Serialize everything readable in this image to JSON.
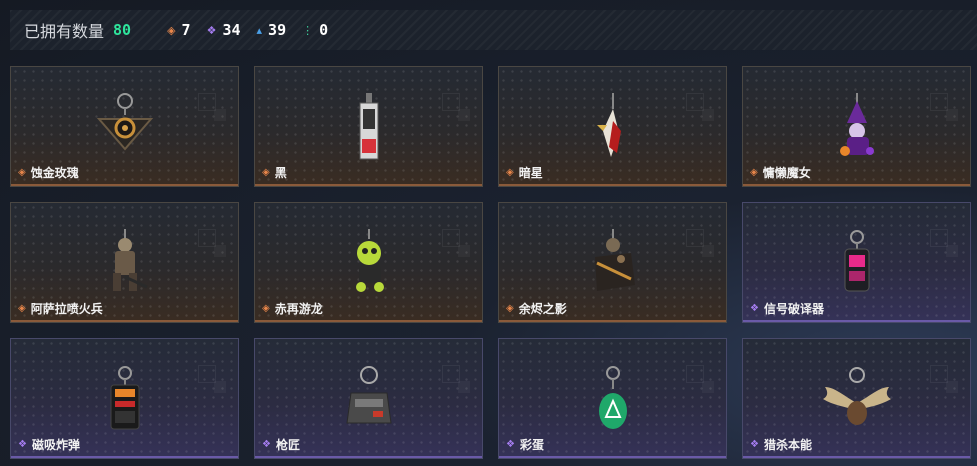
{
  "header": {
    "owned_label": "已拥有数量",
    "owned_count": "80",
    "stats": [
      {
        "icon": "orange-diamond-icon",
        "glyph": "◈",
        "color": "#e8864a",
        "value": "7"
      },
      {
        "icon": "purple-diamond-icon",
        "glyph": "❖",
        "color": "#a57df0",
        "value": "34"
      },
      {
        "icon": "blue-chevron-icon",
        "glyph": "▴",
        "color": "#4aa0e8",
        "value": "39"
      },
      {
        "icon": "green-dots-icon",
        "glyph": "⋮",
        "color": "#3fd7a0",
        "value": "0"
      }
    ]
  },
  "colors": {
    "orange": "#e8864a",
    "purple": "#a57df0"
  },
  "items": [
    {
      "name": "蚀金玫瑰",
      "rarity": "orange",
      "glyph": "◈"
    },
    {
      "name": "黑",
      "rarity": "orange",
      "glyph": "◈"
    },
    {
      "name": "暗星",
      "rarity": "orange",
      "glyph": "◈"
    },
    {
      "name": "慵懒魔女",
      "rarity": "orange",
      "glyph": "◈"
    },
    {
      "name": "阿萨拉喷火兵",
      "rarity": "orange",
      "glyph": "◈"
    },
    {
      "name": "赤再游龙",
      "rarity": "orange",
      "glyph": "◈"
    },
    {
      "name": "余烬之影",
      "rarity": "orange",
      "glyph": "◈"
    },
    {
      "name": "信号破译器",
      "rarity": "purple",
      "glyph": "❖"
    },
    {
      "name": "磁吸炸弹",
      "rarity": "purple",
      "glyph": "❖"
    },
    {
      "name": "枪匠",
      "rarity": "purple",
      "glyph": "❖"
    },
    {
      "name": "彩蛋",
      "rarity": "purple",
      "glyph": "❖"
    },
    {
      "name": "猎杀本能",
      "rarity": "purple",
      "glyph": "❖"
    }
  ]
}
